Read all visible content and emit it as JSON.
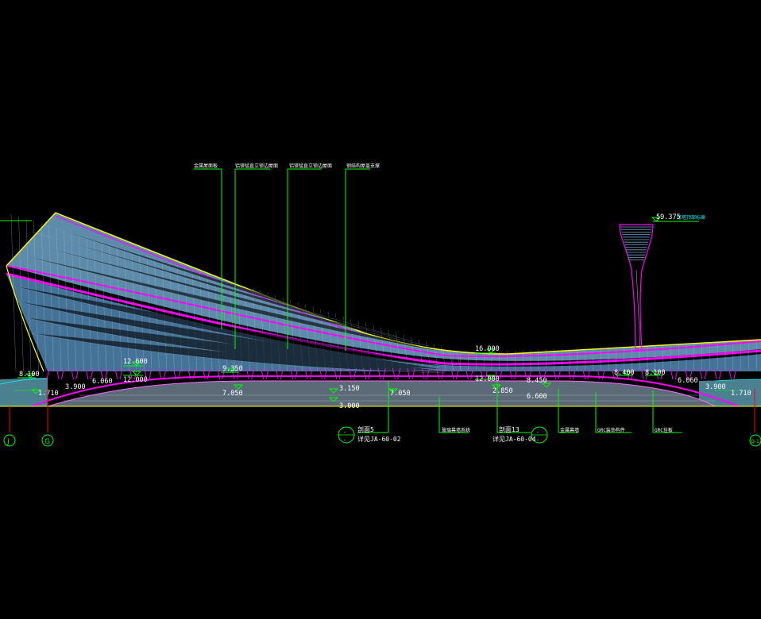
{
  "colors": {
    "background": "#000000",
    "roof_structure": "#ff00ff",
    "roof_fill": "#6fa3c8",
    "leader_lines": "#00ff00",
    "elevation_text": "#ffffff",
    "outline": "#ffff00",
    "grid_line": "#ff0000"
  },
  "elevations": {
    "e_8100_left": "8.100",
    "e_12600": "12.600",
    "e_12000_left": "12.000",
    "e_6060_left": "6.060",
    "e_3900_left": "3.900",
    "e_1710_left": "1.710",
    "e_9350": "9.350",
    "e_7050": "7.050",
    "e_3150": "3.150",
    "e_3000": "3.000",
    "e_7050_b": "7.050",
    "e_16000": "16.000",
    "e_12000_mid": "12.000",
    "e_2850": "2.850",
    "e_8450": "8.450",
    "e_6600": "6.600",
    "e_8400": "8.400",
    "e_8100_right": "8.100",
    "e_6060_right": "6.060",
    "e_3900_right": "3.900",
    "e_1710_right": "1.710",
    "e_59375": "59.375"
  },
  "top_labels": {
    "t1": "金属屋面板",
    "t2": "铝镁锰直立锁边屋面",
    "t3": "铝镁锰直立锁边屋面",
    "t4": "钢结构屋盖支撑"
  },
  "tower_label": "灯塔顶部标高",
  "callouts": {
    "left_upper": "剖面5",
    "left_lower": "详见JA-60-02",
    "mid_upper": "剖面13",
    "mid_lower": "详见JA-60-04",
    "notes": [
      "玻璃幕墙系统",
      "金属幕墙",
      "GRC装饰构件",
      "GRC挂板"
    ]
  },
  "grid_axes": {
    "j": "J",
    "g": "G",
    "right": "Q-1"
  }
}
